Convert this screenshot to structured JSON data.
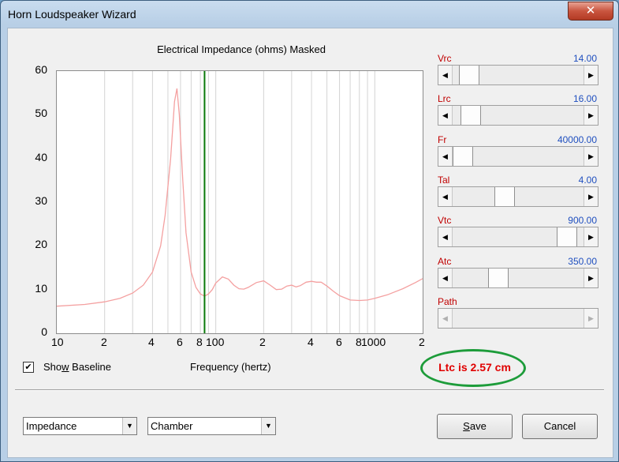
{
  "window": {
    "title": "Horn Loudspeaker Wizard",
    "close_glyph": "✕"
  },
  "chart": {
    "title": "Electrical Impedance (ohms)   Masked"
  },
  "chart_data": {
    "type": "line",
    "title": "Electrical Impedance (ohms)   Masked",
    "xlabel": "Frequency (hertz)",
    "ylabel": "",
    "x_scale": "log",
    "xlim": [
      10,
      2000
    ],
    "ylim": [
      0,
      60
    ],
    "y_ticks": [
      0,
      10,
      20,
      30,
      40,
      50,
      60
    ],
    "x_ticks": [
      "10",
      "2",
      "4",
      "6",
      "8",
      "100",
      "2",
      "4",
      "6",
      "8",
      "1000",
      "2"
    ],
    "marker_frequency": 85,
    "series": [
      {
        "color": "#f4a0a0",
        "x": [
          10,
          15,
          20,
          25,
          30,
          35,
          40,
          45,
          48,
          52,
          55,
          57,
          59,
          62,
          65,
          70,
          75,
          80,
          85,
          90,
          95,
          100,
          110,
          120,
          130,
          140,
          150,
          160,
          180,
          200,
          220,
          240,
          260,
          280,
          300,
          320,
          340,
          370,
          400,
          430,
          460,
          500,
          550,
          600,
          700,
          800,
          900,
          1000,
          1200,
          1500,
          1800,
          2000
        ],
        "values": [
          6.2,
          6.6,
          7.2,
          8.0,
          9.2,
          11.0,
          14.0,
          20.0,
          27.0,
          40.0,
          53.0,
          56.0,
          50.0,
          35.0,
          23.0,
          14.0,
          10.5,
          9.0,
          8.5,
          9.0,
          10.0,
          11.5,
          12.9,
          12.4,
          11.0,
          10.2,
          10.1,
          10.5,
          11.6,
          12.0,
          11.0,
          10.0,
          10.1,
          10.8,
          11.0,
          10.6,
          10.9,
          11.7,
          11.9,
          11.7,
          11.7,
          10.8,
          9.6,
          8.6,
          7.6,
          7.5,
          7.6,
          8.0,
          8.8,
          10.2,
          11.6,
          12.5
        ]
      }
    ]
  },
  "sliders": [
    {
      "label": "Vrc",
      "value": "14.00",
      "pos": 0.06,
      "disabled": false
    },
    {
      "label": "Lrc",
      "value": "16.00",
      "pos": 0.07,
      "disabled": false
    },
    {
      "label": "Fr",
      "value": "40000.00",
      "pos": 0.0,
      "disabled": false
    },
    {
      "label": "Tal",
      "value": "4.00",
      "pos": 0.38,
      "disabled": false
    },
    {
      "label": "Vtc",
      "value": "900.00",
      "pos": 0.94,
      "disabled": false
    },
    {
      "label": "Atc",
      "value": "350.00",
      "pos": 0.32,
      "disabled": false
    },
    {
      "label": "Path",
      "value": "",
      "pos": null,
      "disabled": true
    }
  ],
  "ltc": {
    "text": "Ltc is 2.57 cm"
  },
  "show_baseline": {
    "checked": true,
    "label_before": "Sho",
    "label_key": "w",
    "label_after": " Baseline"
  },
  "frequency_label": "Frequency (hertz)",
  "dropdowns": {
    "left": "Impedance",
    "right": "Chamber"
  },
  "buttons": {
    "save_key": "S",
    "save_rest": "ave",
    "cancel": "Cancel"
  }
}
